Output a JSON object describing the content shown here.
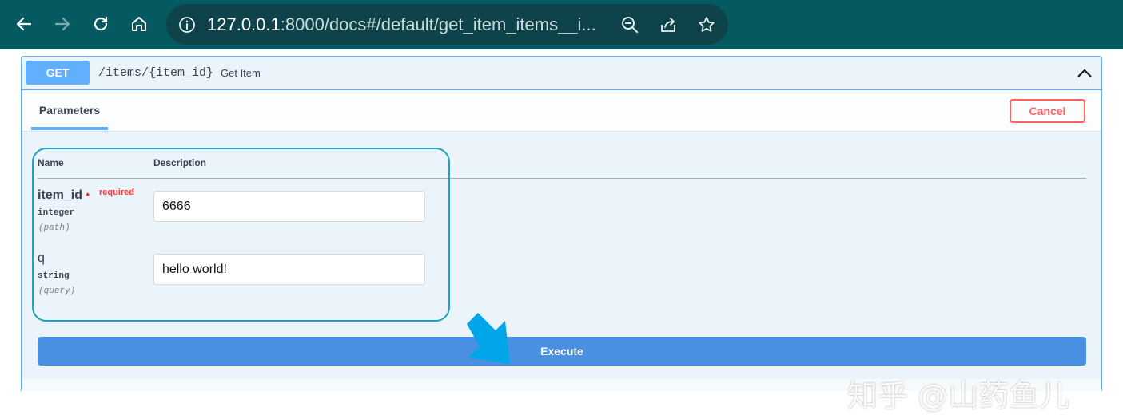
{
  "browser": {
    "url_host": "127.0.0.1",
    "url_rest": ":8000/docs#/default/get_item_items__i..."
  },
  "operation": {
    "method": "GET",
    "path": "/items/{item_id}",
    "summary": "Get Item"
  },
  "parameters_tab": {
    "label": "Parameters",
    "cancel_label": "Cancel",
    "col_name": "Name",
    "col_description": "Description"
  },
  "params": [
    {
      "name": "item_id",
      "required_mark": "*",
      "required_text": "required",
      "type": "integer",
      "in": "(path)",
      "value": "6666"
    },
    {
      "name": "q",
      "type": "string",
      "in": "(query)",
      "value": "hello world!"
    }
  ],
  "execute_label": "Execute",
  "watermark": "知乎 @山药鱼儿",
  "colors": {
    "toolbar": "#055a61",
    "get_method": "#61affe",
    "execute": "#4990e2",
    "cancel": "#ff6060",
    "highlight": "#1ba2c4",
    "arrow": "#00a6e8"
  }
}
